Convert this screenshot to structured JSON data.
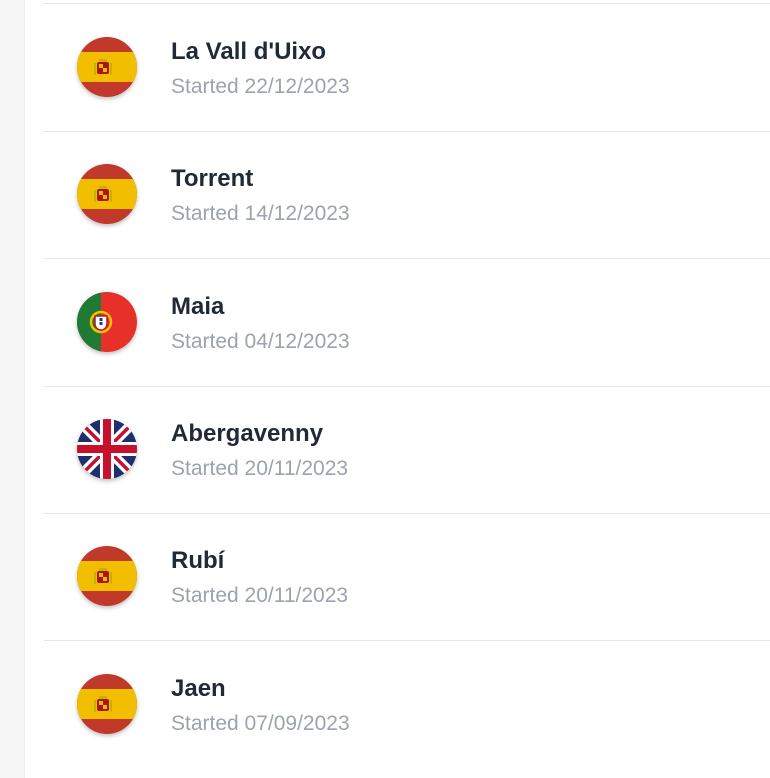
{
  "projects": [
    {
      "name": "La Vall d'Uixo",
      "started": "Started 22/12/2023",
      "flag_icon": "spain-flag-icon",
      "country": "spain"
    },
    {
      "name": "Torrent",
      "started": "Started 14/12/2023",
      "flag_icon": "spain-flag-icon",
      "country": "spain"
    },
    {
      "name": "Maia",
      "started": "Started 04/12/2023",
      "flag_icon": "portugal-flag-icon",
      "country": "portugal"
    },
    {
      "name": "Abergavenny",
      "started": "Started 20/11/2023",
      "flag_icon": "uk-flag-icon",
      "country": "uk"
    },
    {
      "name": "Rubí",
      "started": "Started 20/11/2023",
      "flag_icon": "spain-flag-icon",
      "country": "spain"
    },
    {
      "name": "Jaen",
      "started": "Started 07/09/2023",
      "flag_icon": "spain-flag-icon",
      "country": "spain"
    }
  ],
  "colors": {
    "name_text": "#1f2937",
    "date_text": "#9ca3af",
    "divider": "#e5e7eb"
  }
}
